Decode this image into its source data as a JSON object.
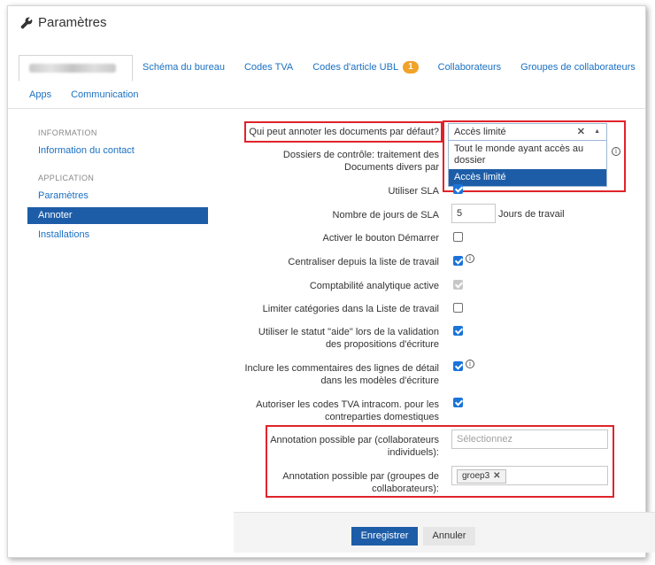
{
  "header": {
    "title": "Paramètres",
    "icon": "wrench-icon"
  },
  "tabs": {
    "row1": [
      {
        "label": "Schéma du bureau"
      },
      {
        "label": "Codes TVA"
      },
      {
        "label": "Codes d'article UBL",
        "badge": "1"
      },
      {
        "label": "Collaborateurs"
      },
      {
        "label": "Groupes de collaborateurs"
      }
    ],
    "row2": [
      {
        "label": "Apps"
      },
      {
        "label": "Communication"
      }
    ]
  },
  "sidebar": {
    "section1": "INFORMATION",
    "item_contact": "Information du contact",
    "section2": "APPLICATION",
    "item_params": "Paramètres",
    "item_annoter": "Annoter",
    "item_installations": "Installations"
  },
  "form": {
    "q_annotate": {
      "label": "Qui peut annoter les documents par défaut?",
      "value": "Accès limité"
    },
    "dropdown_options": [
      "Tout le monde ayant accès au dossier",
      "Accès limité"
    ],
    "controle": {
      "label": "Dossiers de contrôle: traitement des Documents divers par"
    },
    "sla": {
      "label": "Utiliser SLA",
      "checked": true
    },
    "sla_days": {
      "label": "Nombre de jours de SLA",
      "value": "5",
      "suffix": "Jours de travail"
    },
    "demarrer": {
      "label": "Activer le bouton Démarrer",
      "checked": false
    },
    "centraliser": {
      "label": "Centraliser depuis la liste de travail",
      "checked": true
    },
    "analytique": {
      "label": "Comptabilité analytique active",
      "checked": true,
      "disabled": true
    },
    "limiter": {
      "label": "Limiter catégories dans la Liste de travail",
      "checked": false
    },
    "aide": {
      "label": "Utiliser le statut \"aide\" lors de la validation des propositions d'écriture",
      "checked": true
    },
    "commentaires": {
      "label": "Inclure les commentaires des lignes de détail dans les modèles d'écriture",
      "checked": true
    },
    "tva_intracom": {
      "label": "Autoriser les codes TVA intracom. pour les contreparties domestiques",
      "checked": true
    },
    "annot_indiv": {
      "label": "Annotation possible par (collaborateurs individuels):",
      "placeholder": "Sélectionnez"
    },
    "annot_groupes": {
      "label": "Annotation possible par (groupes de collaborateurs):",
      "tag": "groep3"
    }
  },
  "footer": {
    "save": "Enregistrer",
    "cancel": "Annuler"
  },
  "colors": {
    "accent": "#1d5da8",
    "link": "#1a70c2",
    "badge": "#f0a229",
    "highlight_box": "#e0232a"
  }
}
